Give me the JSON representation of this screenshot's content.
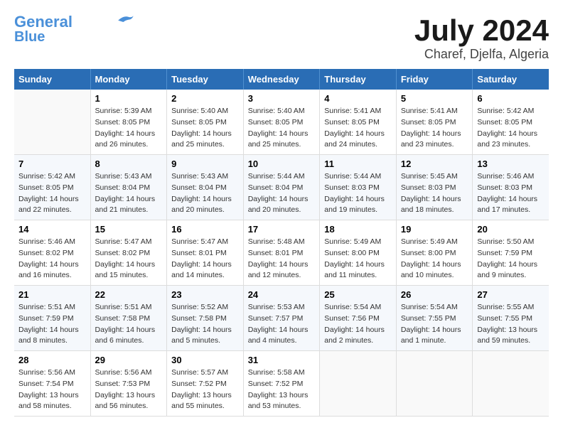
{
  "header": {
    "logo_line1": "General",
    "logo_line2": "Blue",
    "month": "July 2024",
    "location": "Charef, Djelfa, Algeria"
  },
  "weekdays": [
    "Sunday",
    "Monday",
    "Tuesday",
    "Wednesday",
    "Thursday",
    "Friday",
    "Saturday"
  ],
  "weeks": [
    [
      {
        "day": "",
        "info": ""
      },
      {
        "day": "1",
        "info": "Sunrise: 5:39 AM\nSunset: 8:05 PM\nDaylight: 14 hours\nand 26 minutes."
      },
      {
        "day": "2",
        "info": "Sunrise: 5:40 AM\nSunset: 8:05 PM\nDaylight: 14 hours\nand 25 minutes."
      },
      {
        "day": "3",
        "info": "Sunrise: 5:40 AM\nSunset: 8:05 PM\nDaylight: 14 hours\nand 25 minutes."
      },
      {
        "day": "4",
        "info": "Sunrise: 5:41 AM\nSunset: 8:05 PM\nDaylight: 14 hours\nand 24 minutes."
      },
      {
        "day": "5",
        "info": "Sunrise: 5:41 AM\nSunset: 8:05 PM\nDaylight: 14 hours\nand 23 minutes."
      },
      {
        "day": "6",
        "info": "Sunrise: 5:42 AM\nSunset: 8:05 PM\nDaylight: 14 hours\nand 23 minutes."
      }
    ],
    [
      {
        "day": "7",
        "info": "Sunrise: 5:42 AM\nSunset: 8:05 PM\nDaylight: 14 hours\nand 22 minutes."
      },
      {
        "day": "8",
        "info": "Sunrise: 5:43 AM\nSunset: 8:04 PM\nDaylight: 14 hours\nand 21 minutes."
      },
      {
        "day": "9",
        "info": "Sunrise: 5:43 AM\nSunset: 8:04 PM\nDaylight: 14 hours\nand 20 minutes."
      },
      {
        "day": "10",
        "info": "Sunrise: 5:44 AM\nSunset: 8:04 PM\nDaylight: 14 hours\nand 20 minutes."
      },
      {
        "day": "11",
        "info": "Sunrise: 5:44 AM\nSunset: 8:03 PM\nDaylight: 14 hours\nand 19 minutes."
      },
      {
        "day": "12",
        "info": "Sunrise: 5:45 AM\nSunset: 8:03 PM\nDaylight: 14 hours\nand 18 minutes."
      },
      {
        "day": "13",
        "info": "Sunrise: 5:46 AM\nSunset: 8:03 PM\nDaylight: 14 hours\nand 17 minutes."
      }
    ],
    [
      {
        "day": "14",
        "info": "Sunrise: 5:46 AM\nSunset: 8:02 PM\nDaylight: 14 hours\nand 16 minutes."
      },
      {
        "day": "15",
        "info": "Sunrise: 5:47 AM\nSunset: 8:02 PM\nDaylight: 14 hours\nand 15 minutes."
      },
      {
        "day": "16",
        "info": "Sunrise: 5:47 AM\nSunset: 8:01 PM\nDaylight: 14 hours\nand 14 minutes."
      },
      {
        "day": "17",
        "info": "Sunrise: 5:48 AM\nSunset: 8:01 PM\nDaylight: 14 hours\nand 12 minutes."
      },
      {
        "day": "18",
        "info": "Sunrise: 5:49 AM\nSunset: 8:00 PM\nDaylight: 14 hours\nand 11 minutes."
      },
      {
        "day": "19",
        "info": "Sunrise: 5:49 AM\nSunset: 8:00 PM\nDaylight: 14 hours\nand 10 minutes."
      },
      {
        "day": "20",
        "info": "Sunrise: 5:50 AM\nSunset: 7:59 PM\nDaylight: 14 hours\nand 9 minutes."
      }
    ],
    [
      {
        "day": "21",
        "info": "Sunrise: 5:51 AM\nSunset: 7:59 PM\nDaylight: 14 hours\nand 8 minutes."
      },
      {
        "day": "22",
        "info": "Sunrise: 5:51 AM\nSunset: 7:58 PM\nDaylight: 14 hours\nand 6 minutes."
      },
      {
        "day": "23",
        "info": "Sunrise: 5:52 AM\nSunset: 7:58 PM\nDaylight: 14 hours\nand 5 minutes."
      },
      {
        "day": "24",
        "info": "Sunrise: 5:53 AM\nSunset: 7:57 PM\nDaylight: 14 hours\nand 4 minutes."
      },
      {
        "day": "25",
        "info": "Sunrise: 5:54 AM\nSunset: 7:56 PM\nDaylight: 14 hours\nand 2 minutes."
      },
      {
        "day": "26",
        "info": "Sunrise: 5:54 AM\nSunset: 7:55 PM\nDaylight: 14 hours\nand 1 minute."
      },
      {
        "day": "27",
        "info": "Sunrise: 5:55 AM\nSunset: 7:55 PM\nDaylight: 13 hours\nand 59 minutes."
      }
    ],
    [
      {
        "day": "28",
        "info": "Sunrise: 5:56 AM\nSunset: 7:54 PM\nDaylight: 13 hours\nand 58 minutes."
      },
      {
        "day": "29",
        "info": "Sunrise: 5:56 AM\nSunset: 7:53 PM\nDaylight: 13 hours\nand 56 minutes."
      },
      {
        "day": "30",
        "info": "Sunrise: 5:57 AM\nSunset: 7:52 PM\nDaylight: 13 hours\nand 55 minutes."
      },
      {
        "day": "31",
        "info": "Sunrise: 5:58 AM\nSunset: 7:52 PM\nDaylight: 13 hours\nand 53 minutes."
      },
      {
        "day": "",
        "info": ""
      },
      {
        "day": "",
        "info": ""
      },
      {
        "day": "",
        "info": ""
      }
    ]
  ]
}
